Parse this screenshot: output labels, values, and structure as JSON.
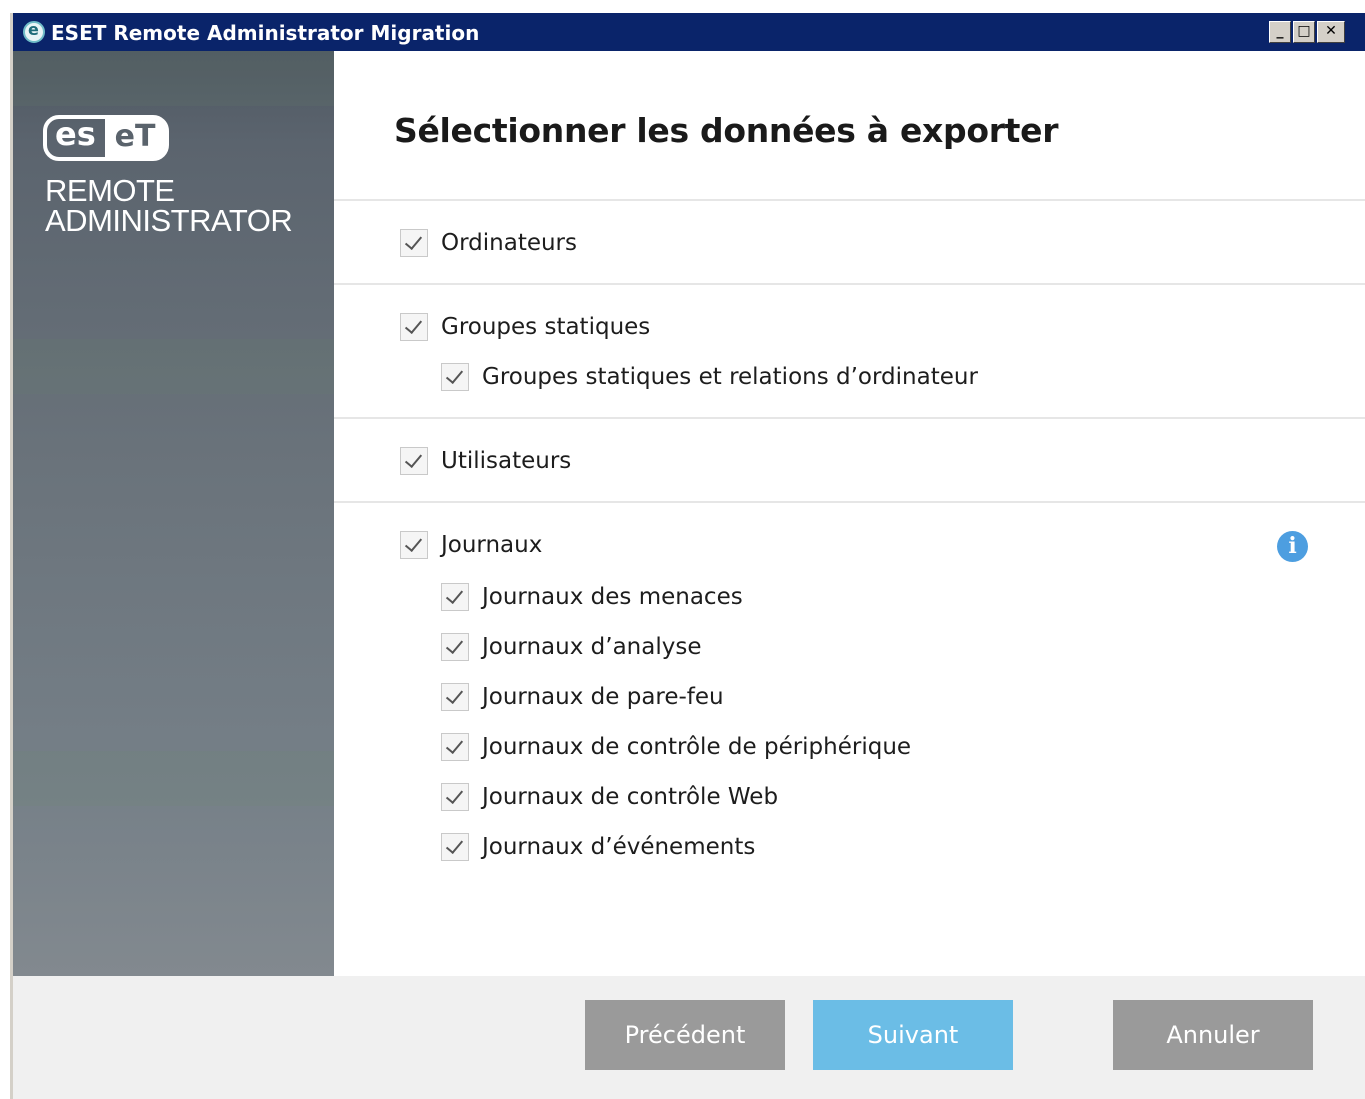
{
  "window": {
    "title": "ESET Remote Administrator Migration",
    "controls": {
      "minimize": "_",
      "maximize": "□",
      "close": "✕"
    }
  },
  "sidebar": {
    "logo": {
      "left": "es",
      "right": "eT"
    },
    "product_line1": "REMOTE",
    "product_line2": "ADMINISTRATOR"
  },
  "main": {
    "title": "Sélectionner les données à exporter",
    "options": {
      "ordinateurs": {
        "label": "Ordinateurs",
        "checked": true
      },
      "groupes_statiques": {
        "label": "Groupes statiques",
        "checked": true
      },
      "groupes_relations": {
        "label": "Groupes statiques et relations d’ordinateur",
        "checked": true
      },
      "utilisateurs": {
        "label": "Utilisateurs",
        "checked": true
      },
      "journaux": {
        "label": "Journaux",
        "checked": true
      },
      "journaux_menaces": {
        "label": "Journaux des menaces",
        "checked": true
      },
      "journaux_analyse": {
        "label": "Journaux d’analyse",
        "checked": true
      },
      "journaux_parefeu": {
        "label": "Journaux de pare-feu",
        "checked": true
      },
      "journaux_peripherique": {
        "label": "Journaux de contrôle de périphérique",
        "checked": true
      },
      "journaux_web": {
        "label": "Journaux de contrôle Web",
        "checked": true
      },
      "journaux_evenements": {
        "label": "Journaux d’événements",
        "checked": true
      }
    },
    "info_icon_glyph": "i"
  },
  "footer": {
    "prev": "Précédent",
    "next": "Suivant",
    "cancel": "Annuler"
  },
  "colors": {
    "titlebar": "#0a246a",
    "next_button": "#6bbde6",
    "disabled_button": "#9a9a9a",
    "info_icon": "#4d9ee0"
  }
}
